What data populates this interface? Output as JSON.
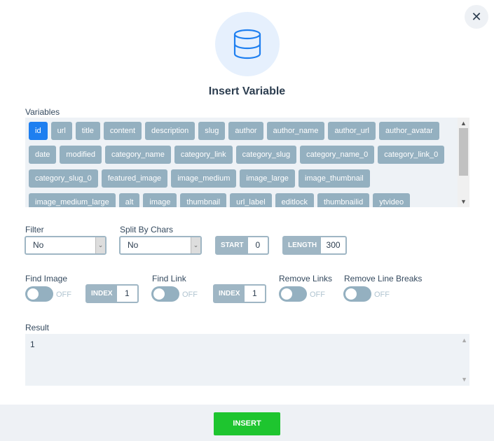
{
  "title": "Insert Variable",
  "icon": "database-icon",
  "close_icon": "close-icon",
  "accent": "#1e7ff0",
  "variables_label": "Variables",
  "variables": [
    "id",
    "url",
    "title",
    "content",
    "description",
    "slug",
    "author",
    "author_name",
    "author_url",
    "author_avatar",
    "date",
    "modified",
    "category_name",
    "category_link",
    "category_slug",
    "category_name_0",
    "category_link_0",
    "category_slug_0",
    "featured_image",
    "image_medium",
    "image_large",
    "image_thumbnail",
    "image_medium_large",
    "alt",
    "image",
    "thumbnail",
    "url_label",
    "editlock",
    "thumbnailid",
    "ytvideo"
  ],
  "selected_variable": "id",
  "filter": {
    "label": "Filter",
    "value": "No"
  },
  "split": {
    "label": "Split By Chars",
    "value": "No"
  },
  "start": {
    "label": "START",
    "value": "0"
  },
  "length": {
    "label": "LENGTH",
    "value": "300"
  },
  "find_image": {
    "label": "Find Image",
    "state": "OFF",
    "index_label": "INDEX",
    "index": "1"
  },
  "find_link": {
    "label": "Find Link",
    "state": "OFF",
    "index_label": "INDEX",
    "index": "1"
  },
  "remove_links": {
    "label": "Remove Links",
    "state": "OFF"
  },
  "remove_line_breaks": {
    "label": "Remove Line Breaks",
    "state": "OFF"
  },
  "result": {
    "label": "Result",
    "value": "1"
  },
  "insert_label": "INSERT"
}
